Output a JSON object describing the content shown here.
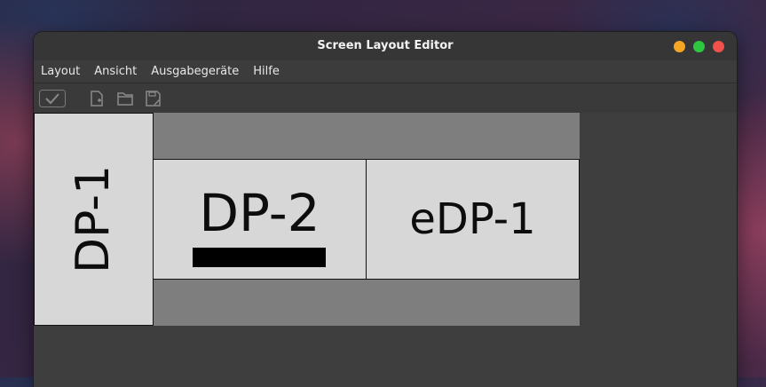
{
  "window": {
    "title": "Screen Layout Editor",
    "buttons": [
      {
        "name": "minimize",
        "color": "#f5a623"
      },
      {
        "name": "maximize",
        "color": "#2ec840"
      },
      {
        "name": "close",
        "color": "#f0514b"
      }
    ]
  },
  "menu": {
    "items": [
      "Layout",
      "Ansicht",
      "Ausgabegeräte",
      "Hilfe"
    ]
  },
  "toolbar": {
    "tools": [
      "apply-icon",
      "new-layout-icon",
      "open-layout-icon",
      "save-layout-icon"
    ]
  },
  "monitors": [
    {
      "name": "DP-1",
      "orientation": "portrait"
    },
    {
      "name": "DP-2",
      "orientation": "landscape",
      "primary": true
    },
    {
      "name": "eDP-1",
      "orientation": "landscape"
    }
  ],
  "colors": {
    "window_bg": "#3c3c3c",
    "virtual_screen": "#7e7e7e",
    "monitor_fill": "#d7d7d7"
  }
}
